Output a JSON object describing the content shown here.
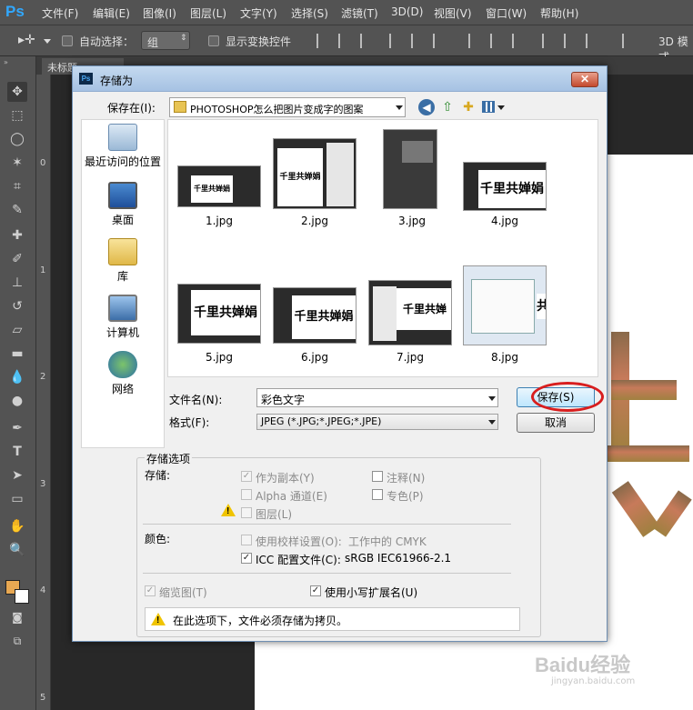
{
  "app": {
    "logo": "Ps",
    "menu": [
      "文件(F)",
      "编辑(E)",
      "图像(I)",
      "图层(L)",
      "文字(Y)",
      "选择(S)",
      "滤镜(T)",
      "3D(D)",
      "视图(V)",
      "窗口(W)",
      "帮助(H)"
    ],
    "options_bar": {
      "auto_select_label": "自动选择：",
      "auto_select_value": "组",
      "show_transform_label": "显示变换控件",
      "mode_3d_label": "3D 模式"
    },
    "doc_tab_label": "未标题",
    "ruler_numbers": [
      "0",
      "1",
      "2",
      "3",
      "4",
      "5"
    ]
  },
  "dialog": {
    "title": "存储为",
    "save_in_label": "保存在(I):",
    "save_in_value": "PHOTOSHOP怎么把图片变成字的图案",
    "places": [
      {
        "label": "最近访问的位置",
        "icon": "recent-places-icon"
      },
      {
        "label": "桌面",
        "icon": "desktop-icon"
      },
      {
        "label": "库",
        "icon": "libraries-icon"
      },
      {
        "label": "计算机",
        "icon": "computer-icon"
      },
      {
        "label": "网络",
        "icon": "network-icon"
      }
    ],
    "files": [
      {
        "name": "1.jpg",
        "thumb_text": "千里共婵娟"
      },
      {
        "name": "2.jpg",
        "thumb_text": "千里共婵娟"
      },
      {
        "name": "3.jpg",
        "thumb_text": ""
      },
      {
        "name": "4.jpg",
        "thumb_text": "千里共婵娟"
      },
      {
        "name": "5.jpg",
        "thumb_text": "千里共婵娟"
      },
      {
        "name": "6.jpg",
        "thumb_text": "千里共婵娟"
      },
      {
        "name": "7.jpg",
        "thumb_text": "千里共婵"
      },
      {
        "name": "8.jpg",
        "thumb_text": "共"
      }
    ],
    "filename_label": "文件名(N):",
    "filename_value": "彩色文字",
    "format_label": "格式(F):",
    "format_value": "JPEG (*.JPG;*.JPEG;*.JPE)",
    "save_button": "保存(S)",
    "cancel_button": "取消",
    "options": {
      "group_title": "存储选项",
      "save_label": "存储:",
      "as_copy": "作为副本(Y)",
      "notes": "注释(N)",
      "alpha": "Alpha 通道(E)",
      "spot": "专色(P)",
      "layers": "图层(L)",
      "color_label": "颜色:",
      "use_proof": "使用校样设置(O):",
      "proof_value": "工作中的 CMYK",
      "icc_profile": "ICC 配置文件(C):",
      "icc_value": "sRGB IEC61966-2.1",
      "thumbnail": "缩览图(T)",
      "lowercase_ext": "使用小写扩展名(U)",
      "warning": "在此选项下，文件必须存储为拷贝。"
    }
  },
  "watermark": {
    "text": "Baidu经验",
    "sub": "jingyan.baidu.com"
  },
  "colors": {
    "ps_blue": "#31a8ff",
    "circle_red": "#d81e1e",
    "fg_swatch": "#e8a852"
  }
}
